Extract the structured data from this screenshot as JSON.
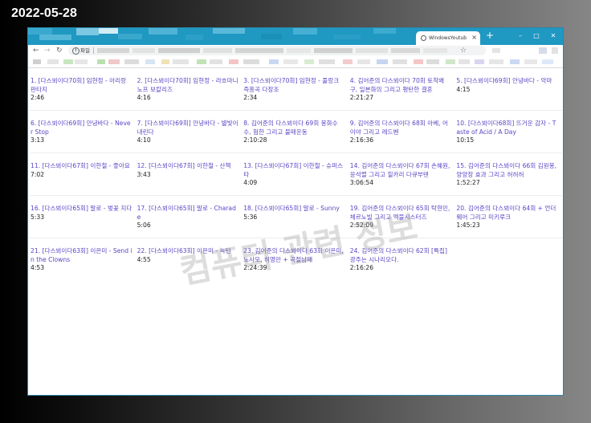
{
  "date_stamp": "2022-05-28",
  "colors": {
    "titlebar": "#1f98c2",
    "link": "#5b44c4",
    "duration": "#222222",
    "watermark": "rgba(150,150,150,0.32)"
  },
  "browser": {
    "tab": {
      "title": "WindowsYoutub",
      "close": "×"
    },
    "new_tab": "+",
    "window_controls": {
      "minimize": "–",
      "maximize": "□",
      "close": "✕"
    },
    "toolbar": {
      "back": "←",
      "forward": "→",
      "reload": "↻",
      "info": "i",
      "scheme_label": "파일",
      "bookmark_star": "☆"
    }
  },
  "watermark": "컴퓨터 관련 정보",
  "videos": [
    {
      "title": "1. [다스뵈이다70회] 임현정 - 아리랑 판타지",
      "duration": "2:46"
    },
    {
      "title": "2. [다스뵈이다70회] 임현정 - 라흐마니노프 보칼리즈",
      "duration": "4:16"
    },
    {
      "title": "3. [다스뵈이다70회] 임현정 - 풀랑크 즉흥곡 다장조",
      "duration": "2:34"
    },
    {
      "title": "4. 김어준의 다스뵈이다 70회 토착왜구, 일본화의 그리고 평탄한 결혼",
      "duration": "2:21:27"
    },
    {
      "title": "5. [다스뵈이다69회] 안녕바다 - 악마",
      "duration": "4:15"
    },
    {
      "title": "6. [다스뵈이다69회] 안녕바다 - Never Stop",
      "duration": "3:13"
    },
    {
      "title": "7. [다스뵈이다69회] 안녕바다 - 별빛이 내린다",
      "duration": "4:10"
    },
    {
      "title": "8. 김어준의 다스뵈이다 69회 봉화수수, 험한 그리고 불매운동",
      "duration": "2:10:28"
    },
    {
      "title": "9. 김어준의 다스뵈이다 68회 아베, 어이야 그리고 레드벤",
      "duration": "2:16:36"
    },
    {
      "title": "10. [다스뵈이다68회] 뜨거운 감자 - Taste of Acid / A Day",
      "duration": "10:15"
    },
    {
      "title": "11. [다스뵈이다67회] 이한철 - 좋아요",
      "duration": "7:02"
    },
    {
      "title": "12. [다스뵈이다67회] 이한철 - 산책",
      "duration": "3:43"
    },
    {
      "title": "13. [다스뵈이다67회] 이한철 - 슈퍼스타",
      "duration": "4:09"
    },
    {
      "title": "14. 김어준의 다스뵈이다 67회 손혜원, 윤석렬 그리고 힐카리 다큐부텐",
      "duration": "3:06:54"
    },
    {
      "title": "15. 김어준의 다스뵈이다 66회 김원봉, 양양장 효과 그리고 허허허",
      "duration": "1:52:27"
    },
    {
      "title": "16. [다스뵈이다65회] 말로 - 벚꽃 지다",
      "duration": "5:33"
    },
    {
      "title": "17. [다스뵈이다65회] 말로 - Charade",
      "duration": "5:06"
    },
    {
      "title": "18. [다스뵈이다65회] 말로 - Sunny",
      "duration": "5:36"
    },
    {
      "title": "19. 김어준의 다스뵈이다 65회 탁현민, 체르노빌 그리고 엑블시스터즈",
      "duration": "2:52:09"
    },
    {
      "title": "20. 김어준의 다스뵈이다 64회 + 언더웨어 그리고 미키루크",
      "duration": "1:45:23"
    },
    {
      "title": "21. [다스뵈이다63회] 이은미 - Send in the Clowns",
      "duration": "4:53"
    },
    {
      "title": "22. [다스뵈이다63회] 이은미 - 녹턴",
      "duration": "4:55"
    },
    {
      "title": "23. 김어준의 다스뵈이다 63회 이은미, 노사모, 허영만 + 곡절남매",
      "duration": "2:24:39"
    },
    {
      "title": "24. 김어준의 다스뵈이다 62회 [특집] 광주는 시나리오다.",
      "duration": "2:16:26"
    }
  ]
}
